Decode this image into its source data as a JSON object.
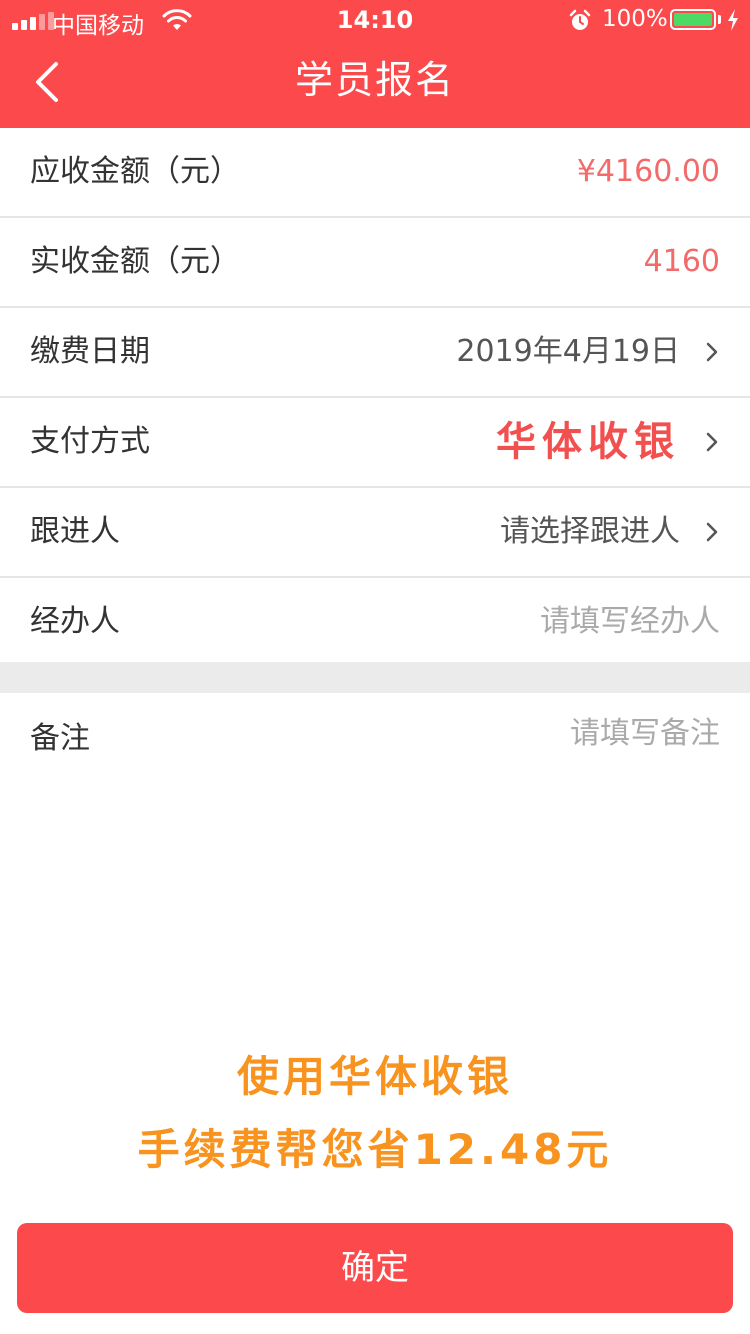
{
  "status_bar": {
    "carrier": "中国移动",
    "time": "14:10",
    "battery_percent": "100%",
    "battery_level": 1.0
  },
  "header": {
    "title": "学员报名",
    "back_icon": "chevron-left-icon"
  },
  "form": {
    "rows": [
      {
        "label": "应收金额（元）",
        "value": "¥4160.00"
      },
      {
        "label": "实收金额（元）",
        "value": "4160"
      },
      {
        "label": "缴费日期",
        "value": "2019年4月19日"
      },
      {
        "label": "支付方式",
        "value": "华体收银"
      },
      {
        "label": "跟进人",
        "value": "请选择跟进人"
      },
      {
        "label": "经办人",
        "value": "请填写经办人"
      }
    ],
    "remark": {
      "label": "备注",
      "placeholder": "请填写备注",
      "value": ""
    }
  },
  "promo": {
    "line1": "使用华体收银",
    "line2": "手续费帮您省12.48元"
  },
  "confirm_button": {
    "label": "确定"
  },
  "colors": {
    "brand_red": "#fc4a4c",
    "amount_red": "#f36a6a",
    "promo_orange": "#f7931e",
    "battery_green": "#4cd964"
  }
}
